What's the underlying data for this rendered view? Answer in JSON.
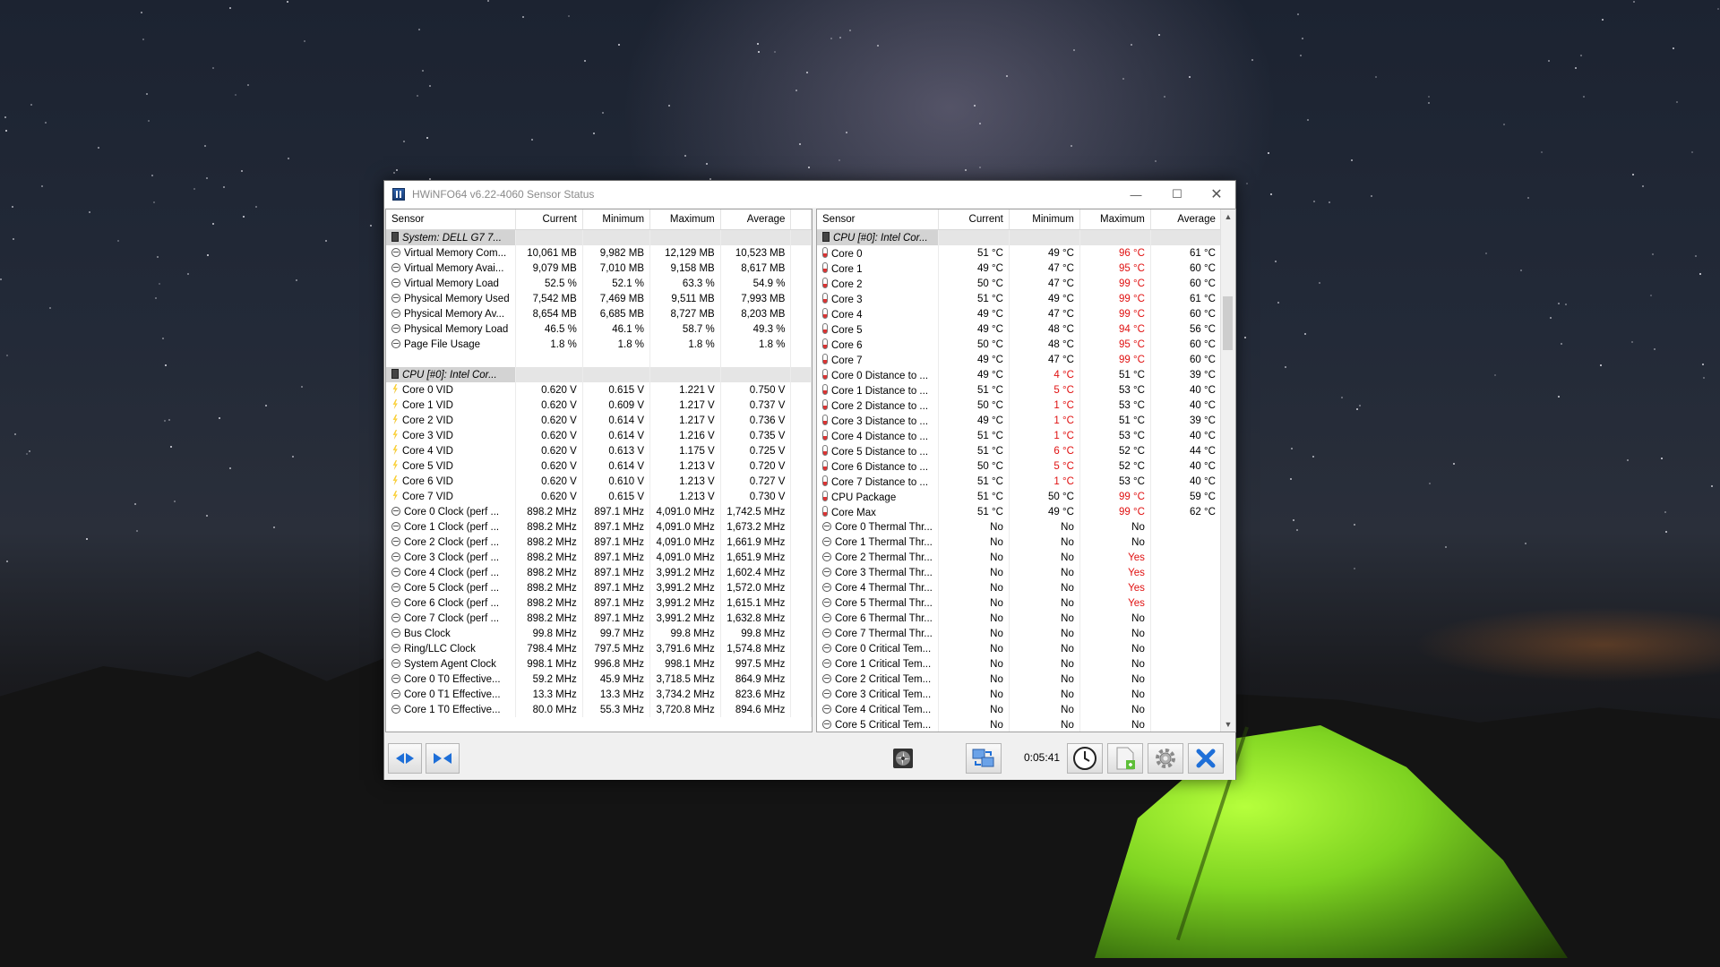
{
  "window": {
    "title": "HWiNFO64 v6.22-4060 Sensor Status",
    "controls": [
      "minimize",
      "maximize",
      "close"
    ]
  },
  "columns": [
    "Sensor",
    "Current",
    "Minimum",
    "Maximum",
    "Average"
  ],
  "left_rows": [
    {
      "type": "group",
      "name": "System: DELL G7 7..."
    },
    {
      "name": "Virtual Memory Com...",
      "icon": "circle",
      "cur": "10,061 MB",
      "min": "9,982 MB",
      "max": "12,129 MB",
      "avg": "10,523 MB"
    },
    {
      "name": "Virtual Memory Avai...",
      "icon": "circle",
      "cur": "9,079 MB",
      "min": "7,010 MB",
      "max": "9,158 MB",
      "avg": "8,617 MB"
    },
    {
      "name": "Virtual Memory Load",
      "icon": "circle",
      "cur": "52.5 %",
      "min": "52.1 %",
      "max": "63.3 %",
      "avg": "54.9 %"
    },
    {
      "name": "Physical Memory Used",
      "icon": "circle",
      "cur": "7,542 MB",
      "min": "7,469 MB",
      "max": "9,511 MB",
      "avg": "7,993 MB"
    },
    {
      "name": "Physical Memory Av...",
      "icon": "circle",
      "cur": "8,654 MB",
      "min": "6,685 MB",
      "max": "8,727 MB",
      "avg": "8,203 MB"
    },
    {
      "name": "Physical Memory Load",
      "icon": "circle",
      "cur": "46.5 %",
      "min": "46.1 %",
      "max": "58.7 %",
      "avg": "49.3 %"
    },
    {
      "name": "Page File Usage",
      "icon": "circle",
      "cur": "1.8 %",
      "min": "1.8 %",
      "max": "1.8 %",
      "avg": "1.8 %"
    },
    {
      "type": "spacer"
    },
    {
      "type": "group",
      "name": "CPU [#0]: Intel Cor..."
    },
    {
      "name": "Core 0 VID",
      "icon": "volt",
      "cur": "0.620 V",
      "min": "0.615 V",
      "max": "1.221 V",
      "avg": "0.750 V"
    },
    {
      "name": "Core 1 VID",
      "icon": "volt",
      "cur": "0.620 V",
      "min": "0.609 V",
      "max": "1.217 V",
      "avg": "0.737 V"
    },
    {
      "name": "Core 2 VID",
      "icon": "volt",
      "cur": "0.620 V",
      "min": "0.614 V",
      "max": "1.217 V",
      "avg": "0.736 V"
    },
    {
      "name": "Core 3 VID",
      "icon": "volt",
      "cur": "0.620 V",
      "min": "0.614 V",
      "max": "1.216 V",
      "avg": "0.735 V"
    },
    {
      "name": "Core 4 VID",
      "icon": "volt",
      "cur": "0.620 V",
      "min": "0.613 V",
      "max": "1.175 V",
      "avg": "0.725 V"
    },
    {
      "name": "Core 5 VID",
      "icon": "volt",
      "cur": "0.620 V",
      "min": "0.614 V",
      "max": "1.213 V",
      "avg": "0.720 V"
    },
    {
      "name": "Core 6 VID",
      "icon": "volt",
      "cur": "0.620 V",
      "min": "0.610 V",
      "max": "1.213 V",
      "avg": "0.727 V"
    },
    {
      "name": "Core 7 VID",
      "icon": "volt",
      "cur": "0.620 V",
      "min": "0.615 V",
      "max": "1.213 V",
      "avg": "0.730 V"
    },
    {
      "name": "Core 0 Clock (perf ...",
      "icon": "circle",
      "cur": "898.2 MHz",
      "min": "897.1 MHz",
      "max": "4,091.0 MHz",
      "avg": "1,742.5 MHz"
    },
    {
      "name": "Core 1 Clock (perf ...",
      "icon": "circle",
      "cur": "898.2 MHz",
      "min": "897.1 MHz",
      "max": "4,091.0 MHz",
      "avg": "1,673.2 MHz"
    },
    {
      "name": "Core 2 Clock (perf ...",
      "icon": "circle",
      "cur": "898.2 MHz",
      "min": "897.1 MHz",
      "max": "4,091.0 MHz",
      "avg": "1,661.9 MHz"
    },
    {
      "name": "Core 3 Clock (perf ...",
      "icon": "circle",
      "cur": "898.2 MHz",
      "min": "897.1 MHz",
      "max": "4,091.0 MHz",
      "avg": "1,651.9 MHz"
    },
    {
      "name": "Core 4 Clock (perf ...",
      "icon": "circle",
      "cur": "898.2 MHz",
      "min": "897.1 MHz",
      "max": "3,991.2 MHz",
      "avg": "1,602.4 MHz"
    },
    {
      "name": "Core 5 Clock (perf ...",
      "icon": "circle",
      "cur": "898.2 MHz",
      "min": "897.1 MHz",
      "max": "3,991.2 MHz",
      "avg": "1,572.0 MHz"
    },
    {
      "name": "Core 6 Clock (perf ...",
      "icon": "circle",
      "cur": "898.2 MHz",
      "min": "897.1 MHz",
      "max": "3,991.2 MHz",
      "avg": "1,615.1 MHz"
    },
    {
      "name": "Core 7 Clock (perf ...",
      "icon": "circle",
      "cur": "898.2 MHz",
      "min": "897.1 MHz",
      "max": "3,991.2 MHz",
      "avg": "1,632.8 MHz"
    },
    {
      "name": "Bus Clock",
      "icon": "circle",
      "cur": "99.8 MHz",
      "min": "99.7 MHz",
      "max": "99.8 MHz",
      "avg": "99.8 MHz"
    },
    {
      "name": "Ring/LLC Clock",
      "icon": "circle",
      "cur": "798.4 MHz",
      "min": "797.5 MHz",
      "max": "3,791.6 MHz",
      "avg": "1,574.8 MHz"
    },
    {
      "name": "System Agent Clock",
      "icon": "circle",
      "cur": "998.1 MHz",
      "min": "996.8 MHz",
      "max": "998.1 MHz",
      "avg": "997.5 MHz"
    },
    {
      "name": "Core 0 T0 Effective...",
      "icon": "circle",
      "cur": "59.2 MHz",
      "min": "45.9 MHz",
      "max": "3,718.5 MHz",
      "avg": "864.9 MHz"
    },
    {
      "name": "Core 0 T1 Effective...",
      "icon": "circle",
      "cur": "13.3 MHz",
      "min": "13.3 MHz",
      "max": "3,734.2 MHz",
      "avg": "823.6 MHz"
    },
    {
      "name": "Core 1 T0 Effective...",
      "icon": "circle",
      "cur": "80.0 MHz",
      "min": "55.3 MHz",
      "max": "3,720.8 MHz",
      "avg": "894.6 MHz"
    }
  ],
  "right_rows": [
    {
      "type": "group",
      "name": "CPU [#0]: Intel Cor..."
    },
    {
      "name": "Core 0",
      "icon": "therm",
      "cur": "51 °C",
      "min": "49 °C",
      "max": "96 °C",
      "avg": "61 °C",
      "maxRed": true
    },
    {
      "name": "Core 1",
      "icon": "therm",
      "cur": "49 °C",
      "min": "47 °C",
      "max": "95 °C",
      "avg": "60 °C",
      "maxRed": true
    },
    {
      "name": "Core 2",
      "icon": "therm",
      "cur": "50 °C",
      "min": "47 °C",
      "max": "99 °C",
      "avg": "60 °C",
      "maxRed": true
    },
    {
      "name": "Core 3",
      "icon": "therm",
      "cur": "51 °C",
      "min": "49 °C",
      "max": "99 °C",
      "avg": "61 °C",
      "maxRed": true
    },
    {
      "name": "Core 4",
      "icon": "therm",
      "cur": "49 °C",
      "min": "47 °C",
      "max": "99 °C",
      "avg": "60 °C",
      "maxRed": true
    },
    {
      "name": "Core 5",
      "icon": "therm",
      "cur": "49 °C",
      "min": "48 °C",
      "max": "94 °C",
      "avg": "56 °C",
      "maxRed": true
    },
    {
      "name": "Core 6",
      "icon": "therm",
      "cur": "50 °C",
      "min": "48 °C",
      "max": "95 °C",
      "avg": "60 °C",
      "maxRed": true
    },
    {
      "name": "Core 7",
      "icon": "therm",
      "cur": "49 °C",
      "min": "47 °C",
      "max": "99 °C",
      "avg": "60 °C",
      "maxRed": true
    },
    {
      "name": "Core 0 Distance to ...",
      "icon": "therm",
      "cur": "49 °C",
      "min": "4 °C",
      "max": "51 °C",
      "avg": "39 °C",
      "minRed": true
    },
    {
      "name": "Core 1 Distance to ...",
      "icon": "therm",
      "cur": "51 °C",
      "min": "5 °C",
      "max": "53 °C",
      "avg": "40 °C",
      "minRed": true
    },
    {
      "name": "Core 2 Distance to ...",
      "icon": "therm",
      "cur": "50 °C",
      "min": "1 °C",
      "max": "53 °C",
      "avg": "40 °C",
      "minRed": true
    },
    {
      "name": "Core 3 Distance to ...",
      "icon": "therm",
      "cur": "49 °C",
      "min": "1 °C",
      "max": "51 °C",
      "avg": "39 °C",
      "minRed": true
    },
    {
      "name": "Core 4 Distance to ...",
      "icon": "therm",
      "cur": "51 °C",
      "min": "1 °C",
      "max": "53 °C",
      "avg": "40 °C",
      "minRed": true
    },
    {
      "name": "Core 5 Distance to ...",
      "icon": "therm",
      "cur": "51 °C",
      "min": "6 °C",
      "max": "52 °C",
      "avg": "44 °C",
      "minRed": true
    },
    {
      "name": "Core 6 Distance to ...",
      "icon": "therm",
      "cur": "50 °C",
      "min": "5 °C",
      "max": "52 °C",
      "avg": "40 °C",
      "minRed": true
    },
    {
      "name": "Core 7 Distance to ...",
      "icon": "therm",
      "cur": "51 °C",
      "min": "1 °C",
      "max": "53 °C",
      "avg": "40 °C",
      "minRed": true
    },
    {
      "name": "CPU Package",
      "icon": "therm",
      "cur": "51 °C",
      "min": "50 °C",
      "max": "99 °C",
      "avg": "59 °C",
      "maxRed": true
    },
    {
      "name": "Core Max",
      "icon": "therm",
      "cur": "51 °C",
      "min": "49 °C",
      "max": "99 °C",
      "avg": "62 °C",
      "maxRed": true
    },
    {
      "name": "Core 0 Thermal Thr...",
      "icon": "circle",
      "cur": "No",
      "min": "No",
      "max": "No",
      "avg": ""
    },
    {
      "name": "Core 1 Thermal Thr...",
      "icon": "circle",
      "cur": "No",
      "min": "No",
      "max": "No",
      "avg": ""
    },
    {
      "name": "Core 2 Thermal Thr...",
      "icon": "circle",
      "cur": "No",
      "min": "No",
      "max": "Yes",
      "avg": "",
      "maxRed": true
    },
    {
      "name": "Core 3 Thermal Thr...",
      "icon": "circle",
      "cur": "No",
      "min": "No",
      "max": "Yes",
      "avg": "",
      "maxRed": true
    },
    {
      "name": "Core 4 Thermal Thr...",
      "icon": "circle",
      "cur": "No",
      "min": "No",
      "max": "Yes",
      "avg": "",
      "maxRed": true
    },
    {
      "name": "Core 5 Thermal Thr...",
      "icon": "circle",
      "cur": "No",
      "min": "No",
      "max": "Yes",
      "avg": "",
      "maxRed": true
    },
    {
      "name": "Core 6 Thermal Thr...",
      "icon": "circle",
      "cur": "No",
      "min": "No",
      "max": "No",
      "avg": ""
    },
    {
      "name": "Core 7 Thermal Thr...",
      "icon": "circle",
      "cur": "No",
      "min": "No",
      "max": "No",
      "avg": ""
    },
    {
      "name": "Core 0 Critical Tem...",
      "icon": "circle",
      "cur": "No",
      "min": "No",
      "max": "No",
      "avg": ""
    },
    {
      "name": "Core 1 Critical Tem...",
      "icon": "circle",
      "cur": "No",
      "min": "No",
      "max": "No",
      "avg": ""
    },
    {
      "name": "Core 2 Critical Tem...",
      "icon": "circle",
      "cur": "No",
      "min": "No",
      "max": "No",
      "avg": ""
    },
    {
      "name": "Core 3 Critical Tem...",
      "icon": "circle",
      "cur": "No",
      "min": "No",
      "max": "No",
      "avg": ""
    },
    {
      "name": "Core 4 Critical Tem...",
      "icon": "circle",
      "cur": "No",
      "min": "No",
      "max": "No",
      "avg": ""
    },
    {
      "name": "Core 5 Critical Tem...",
      "icon": "circle",
      "cur": "No",
      "min": "No",
      "max": "No",
      "avg": ""
    }
  ],
  "toolbar": {
    "timer": "0:05:41",
    "buttons": [
      "expand-icon",
      "collapse-icon",
      "fan-icon",
      "network-icon",
      "clock-icon",
      "report-icon",
      "settings-icon",
      "close-icon"
    ]
  },
  "colors": {
    "alert": "#e01010",
    "accent": "#1e6fd8"
  }
}
